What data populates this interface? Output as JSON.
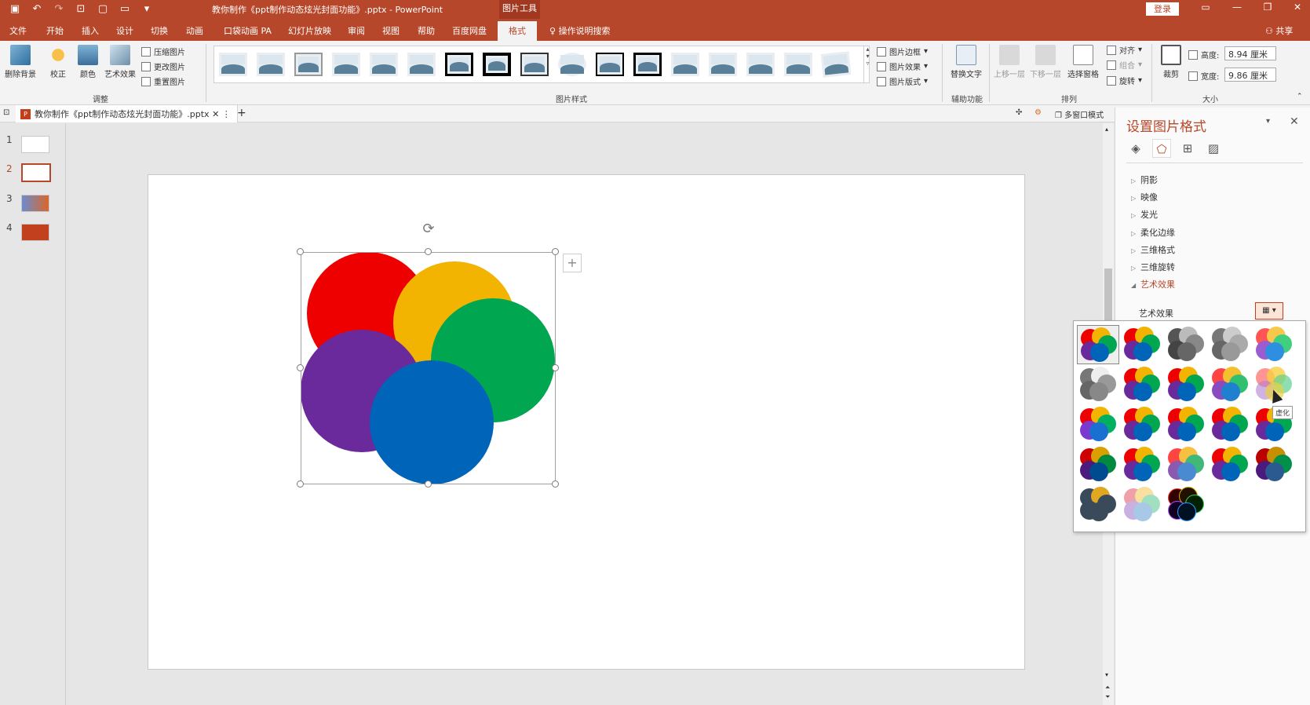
{
  "titlebar": {
    "title": "教你制作《ppt制作动态炫光封面功能》.pptx  -  PowerPoint",
    "context_tool": "图片工具",
    "login": "登录",
    "icons": [
      "save-icon",
      "undo-icon",
      "redo-icon",
      "start-icon",
      "new-icon",
      "open-icon",
      "customize-icon"
    ]
  },
  "tabs": [
    {
      "label": "文件",
      "active": false
    },
    {
      "label": "开始",
      "active": false
    },
    {
      "label": "插入",
      "active": false
    },
    {
      "label": "设计",
      "active": false
    },
    {
      "label": "切换",
      "active": false
    },
    {
      "label": "动画",
      "active": false
    },
    {
      "label": "口袋动画 PA",
      "active": false
    },
    {
      "label": "幻灯片放映",
      "active": false
    },
    {
      "label": "审阅",
      "active": false
    },
    {
      "label": "视图",
      "active": false
    },
    {
      "label": "帮助",
      "active": false
    },
    {
      "label": "百度网盘",
      "active": false
    },
    {
      "label": "格式",
      "active": true
    }
  ],
  "search_tab": "操作说明搜索",
  "share": "共享",
  "ribbon": {
    "adjust": {
      "remove_bg": "删除背景",
      "correct": "校正",
      "color": "颜色",
      "artistic": "艺术效果",
      "compress": "压缩图片",
      "change": "更改图片",
      "reset": "重置图片",
      "group_label": "调整"
    },
    "styles": {
      "border": "图片边框",
      "effect": "图片效果",
      "layout": "图片版式",
      "group_label": "图片样式"
    },
    "accessibility": {
      "alt_text": "替换文字",
      "group_label": "辅助功能"
    },
    "arrange": {
      "bring_forward": "上移一层",
      "send_backward": "下移一层",
      "selection_pane": "选择窗格",
      "align": "对齐",
      "group": "组合",
      "rotate": "旋转",
      "group_label": "排列"
    },
    "size": {
      "crop": "裁剪",
      "height_label": "高度:",
      "height_value": "8.94 厘米",
      "width_label": "宽度:",
      "width_value": "9.86 厘米",
      "group_label": "大小"
    }
  },
  "doc_tab": "教你制作《ppt制作动态炫光封面功能》.pptx",
  "multi_window": "多窗口模式",
  "slides": [
    {
      "num": "1",
      "active": false
    },
    {
      "num": "2",
      "active": true
    },
    {
      "num": "3",
      "active": false
    },
    {
      "num": "4",
      "active": false
    }
  ],
  "pane": {
    "title": "设置图片格式",
    "sections": [
      {
        "label": "阴影",
        "open": false
      },
      {
        "label": "映像",
        "open": false
      },
      {
        "label": "发光",
        "open": false
      },
      {
        "label": "柔化边缘",
        "open": false
      },
      {
        "label": "三维格式",
        "open": false
      },
      {
        "label": "三维旋转",
        "open": false
      },
      {
        "label": "艺术效果",
        "open": true
      }
    ],
    "art_effect_label": "艺术效果"
  },
  "tooltip": "虚化",
  "colors": {
    "red": "#ee0000",
    "yellow": "#f2b400",
    "green": "#00a650",
    "purple": "#6a2a9c",
    "blue": "#0064b8",
    "accent": "#b7472a"
  }
}
